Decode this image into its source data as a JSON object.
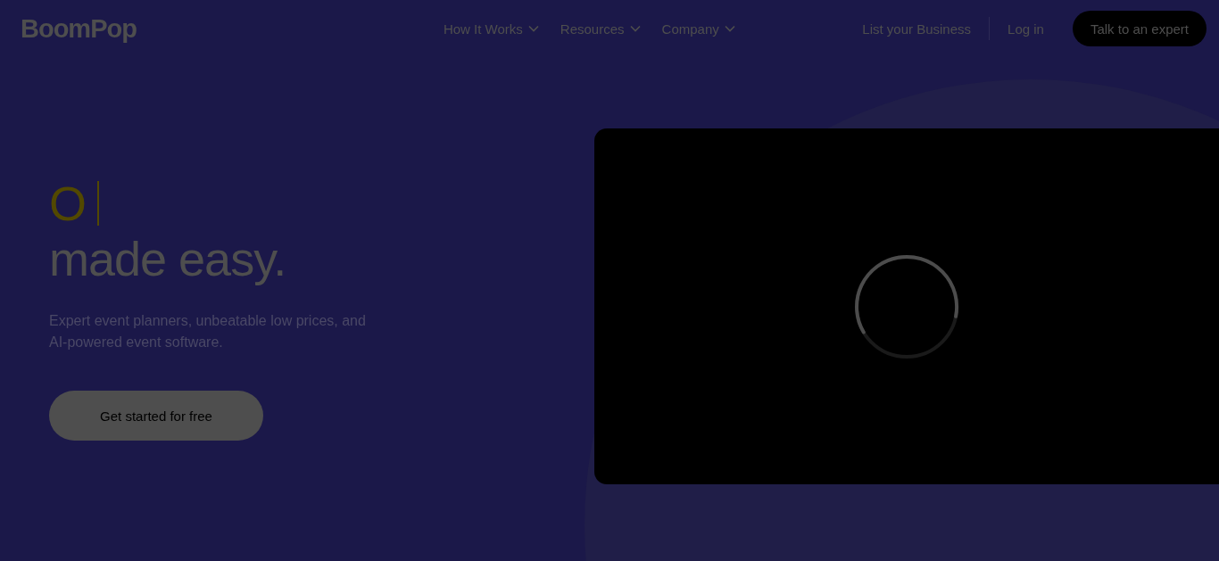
{
  "logo": "BoomPop",
  "nav": [
    {
      "label": "How It Works",
      "dropdown": true
    },
    {
      "label": "Resources",
      "dropdown": true
    },
    {
      "label": "Company",
      "dropdown": true
    }
  ],
  "nav_links": [
    "List your Business",
    "Log in"
  ],
  "cta_button": "Talk to an expert",
  "hero": {
    "typed_word": "O",
    "headline": "made easy.",
    "subtitle": "Expert event planners, unbeatable low prices, and AI-powered event software.",
    "button": "Get started for free"
  },
  "video": {
    "loading": true
  }
}
